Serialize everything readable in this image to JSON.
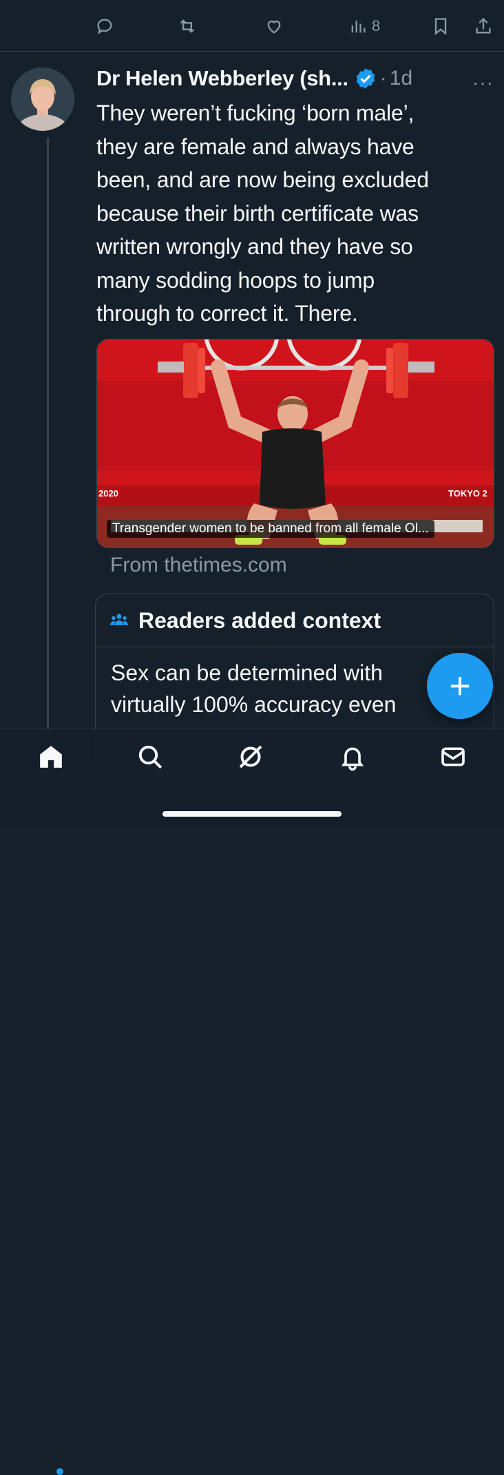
{
  "top_actions": {
    "views_count": "8"
  },
  "tweet": {
    "author_name": "Dr Helen Webberley (sh...",
    "separator": "·",
    "time": "1d",
    "more": "···",
    "text_lines": [
      "They weren’t fucking ‘born male’,",
      "they are female and always have",
      "been, and are now being excluded",
      "because their birth certificate was",
      "written wrongly and they have so",
      "many sodding hoops to jump",
      "through to correct it. There."
    ]
  },
  "media": {
    "caption": "Transgender women to be banned from all female Ol...",
    "banner_left": "2020",
    "banner_right": "TOKYO 2"
  },
  "link_source": "From thetimes.com",
  "context": {
    "title": "Readers added context",
    "body_lines": [
      "Sex can be determined with",
      "virtually 100% accuracy even"
    ]
  },
  "fab": {
    "label": "+"
  },
  "colors": {
    "background": "#15202b",
    "accent": "#1d9bf0",
    "secondary_text": "#8b98a5"
  },
  "icons": {
    "top_actions": [
      "reply-icon",
      "retweet-icon",
      "like-icon",
      "views-icon",
      "bookmark-icon",
      "share-icon"
    ],
    "nav": [
      "home-icon",
      "search-icon",
      "grok-icon",
      "notifications-icon",
      "messages-icon"
    ]
  }
}
